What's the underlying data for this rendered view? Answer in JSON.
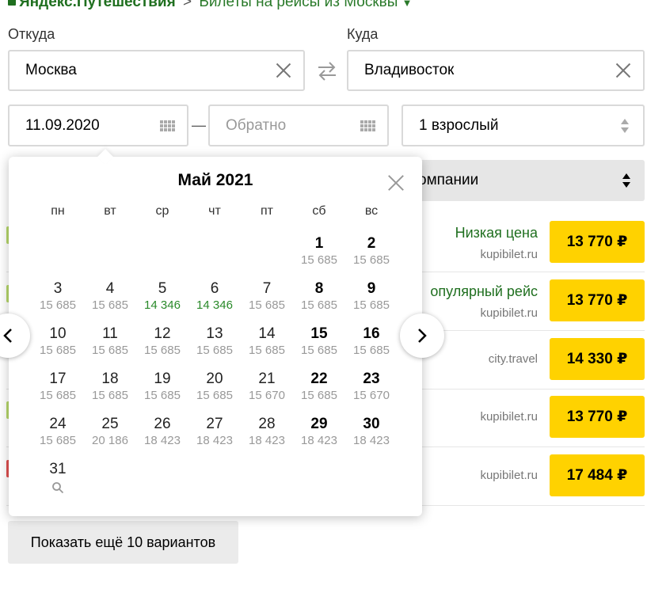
{
  "header": {
    "brand": "Яндекс.Путешествия",
    "separator": ">",
    "breadcrumb": "Билеты на рейсы из Москвы"
  },
  "search": {
    "from_label": "Откуда",
    "to_label": "Куда",
    "from_value": "Москва",
    "to_value": "Владивосток",
    "depart_date": "11.09.2020",
    "return_placeholder": "Обратно",
    "date_dash": "—",
    "passengers": "1 взрослый"
  },
  "sort": {
    "label": "омпании"
  },
  "offers": [
    {
      "tag": "Низкая цена",
      "source": "kupibilet.ru",
      "price": "13 770 ₽",
      "mark_color": "#b7d86b"
    },
    {
      "tag": "опулярный рейс",
      "source": "kupibilet.ru",
      "price": "13 770 ₽",
      "mark_color": "#b7d86b"
    },
    {
      "tag": "",
      "source": "city.travel",
      "price": "14 330 ₽",
      "mark_color": ""
    },
    {
      "tag": "",
      "source": "kupibilet.ru",
      "price": "13 770 ₽",
      "mark_color": "#b7d86b"
    },
    {
      "tag": "",
      "source": "kupibilet.ru",
      "price": "17 484 ₽",
      "mark_color": "#e05050"
    }
  ],
  "more_button": "Показать ещё 10 вариантов",
  "calendar": {
    "month": "Май 2021",
    "weekdays": [
      "пн",
      "вт",
      "ср",
      "чт",
      "пт",
      "сб",
      "вс"
    ],
    "days": [
      {
        "n": "1",
        "p": "15 685"
      },
      {
        "n": "2",
        "p": "15 685"
      },
      {
        "n": "3",
        "p": "15 685"
      },
      {
        "n": "4",
        "p": "15 685"
      },
      {
        "n": "5",
        "p": "14 346"
      },
      {
        "n": "6",
        "p": "14 346"
      },
      {
        "n": "7",
        "p": "15 685"
      },
      {
        "n": "8",
        "p": "15 685"
      },
      {
        "n": "9",
        "p": "15 685"
      },
      {
        "n": "10",
        "p": "15 685"
      },
      {
        "n": "11",
        "p": "15 685"
      },
      {
        "n": "12",
        "p": "15 685"
      },
      {
        "n": "13",
        "p": "15 685"
      },
      {
        "n": "14",
        "p": "15 685"
      },
      {
        "n": "15",
        "p": "15 685"
      },
      {
        "n": "16",
        "p": "15 685"
      },
      {
        "n": "17",
        "p": "15 685"
      },
      {
        "n": "18",
        "p": "15 685"
      },
      {
        "n": "19",
        "p": "15 685"
      },
      {
        "n": "20",
        "p": "15 685"
      },
      {
        "n": "21",
        "p": "15 670"
      },
      {
        "n": "22",
        "p": "15 685"
      },
      {
        "n": "23",
        "p": "15 670"
      },
      {
        "n": "24",
        "p": "15 685"
      },
      {
        "n": "25",
        "p": "20 186"
      },
      {
        "n": "26",
        "p": "18 423"
      },
      {
        "n": "27",
        "p": "18 423"
      },
      {
        "n": "28",
        "p": "18 423"
      },
      {
        "n": "29",
        "p": "18 423"
      },
      {
        "n": "30",
        "p": "18 423"
      },
      {
        "n": "31",
        "p": ""
      }
    ],
    "cheap_color": "#2a8a2a"
  },
  "colors": {
    "accent_yellow": "#ffd200",
    "brand_green": "#1f6f1f"
  }
}
